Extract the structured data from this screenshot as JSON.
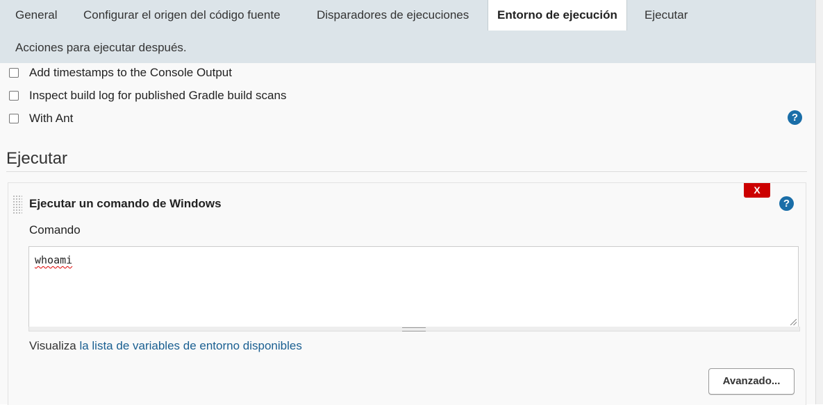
{
  "tabs": {
    "general": "General",
    "scm": "Configurar el origen del código fuente",
    "triggers": "Disparadores de ejecuciones",
    "environment": "Entorno de ejecución",
    "build": "Ejecutar",
    "post_build": "Acciones para ejecutar después."
  },
  "build_environment": {
    "options": [
      {
        "label": "Add timestamps to the Console Output",
        "checked": false
      },
      {
        "label": "Inspect build log for published Gradle build scans",
        "checked": false
      },
      {
        "label": "With Ant",
        "checked": false
      }
    ]
  },
  "build_section": {
    "title": "Ejecutar",
    "step": {
      "delete_label": "X",
      "title": "Ejecutar un comando de Windows",
      "command_label": "Comando",
      "command_value": "whoami",
      "help_prefix": "Visualiza ",
      "help_link": "la lista de variables de entorno disponibles",
      "advanced_label": "Avanzado..."
    }
  },
  "icons": {
    "help": "?"
  },
  "colors": {
    "tabbar_bg": "#dce4e9",
    "help_icon": "#1a6ea8",
    "delete_button": "#cc0000",
    "link": "#1a5f91"
  }
}
